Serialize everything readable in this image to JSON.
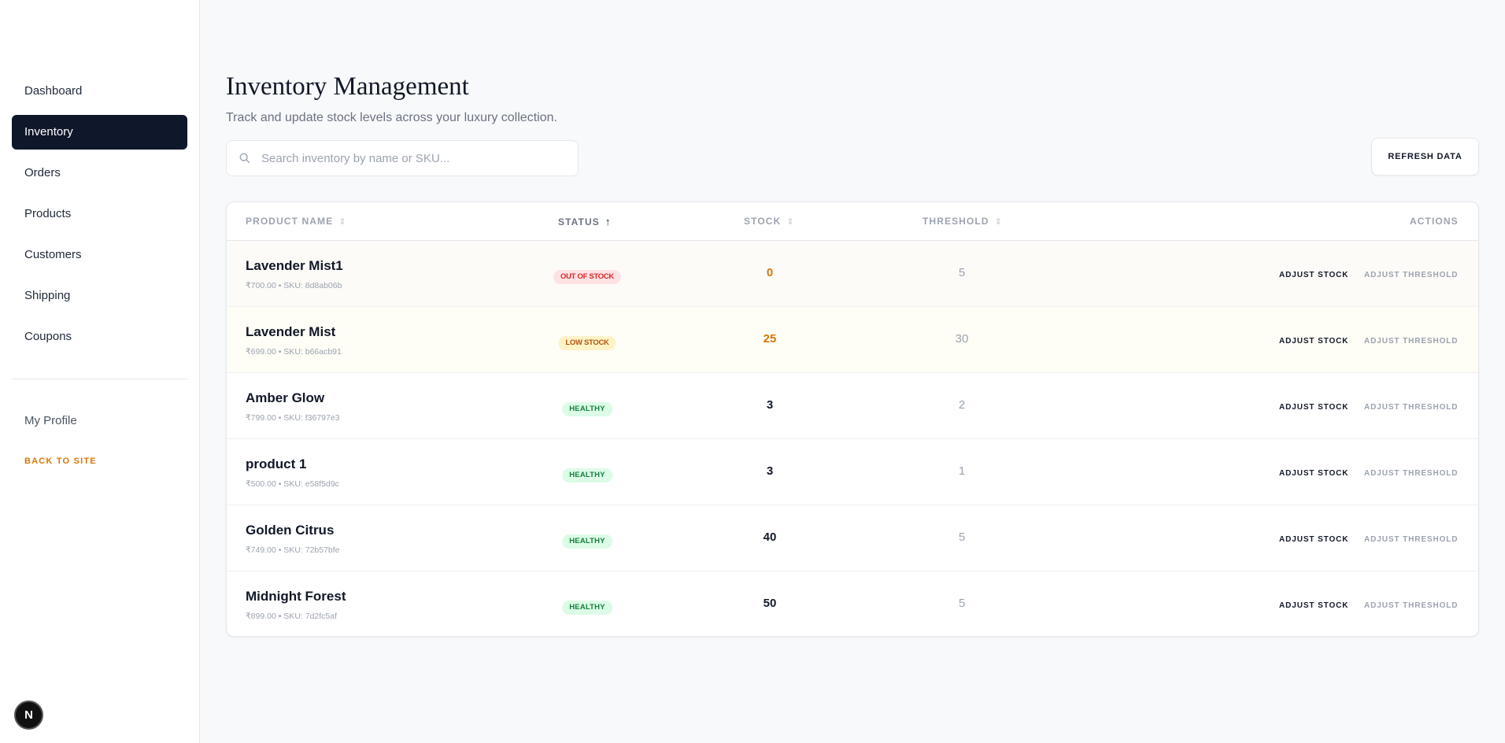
{
  "sidebar": {
    "items": [
      {
        "label": "Dashboard"
      },
      {
        "label": "Inventory"
      },
      {
        "label": "Orders"
      },
      {
        "label": "Products"
      },
      {
        "label": "Customers"
      },
      {
        "label": "Shipping"
      },
      {
        "label": "Coupons"
      }
    ],
    "active_index": 1,
    "profile_label": "My Profile",
    "back_label": "BACK TO SITE",
    "badge_letter": "N"
  },
  "header": {
    "title": "Inventory Management",
    "subtitle": "Track and update stock levels across your luxury collection."
  },
  "search": {
    "placeholder": "Search inventory by name or SKU...",
    "value": "",
    "icon": "search-icon"
  },
  "toolbar": {
    "refresh_label": "REFRESH DATA"
  },
  "table": {
    "columns": {
      "name": "PRODUCT NAME",
      "status": "STATUS",
      "stock": "STOCK",
      "threshold": "THRESHOLD",
      "actions": "ACTIONS"
    },
    "sorted_column": "status",
    "sort_direction": "ascending",
    "rows": [
      {
        "name": "Lavender Mist1",
        "meta": "₹700.00 • SKU: 8d8ab06b",
        "status": "OUT OF STOCK",
        "stock": "0",
        "threshold": "5",
        "adjust_stock": "ADJUST STOCK",
        "adjust_threshold": "ADJUST THRESHOLD"
      },
      {
        "name": "Lavender Mist",
        "meta": "₹699.00 • SKU: b66acb91",
        "status": "LOW STOCK",
        "stock": "25",
        "threshold": "30",
        "adjust_stock": "ADJUST STOCK",
        "adjust_threshold": "ADJUST THRESHOLD"
      },
      {
        "name": "Amber Glow",
        "meta": "₹799.00 • SKU: f36797e3",
        "status": "HEALTHY",
        "stock": "3",
        "threshold": "2",
        "adjust_stock": "ADJUST STOCK",
        "adjust_threshold": "ADJUST THRESHOLD"
      },
      {
        "name": "product 1",
        "meta": "₹500.00 • SKU: e58f5d9c",
        "status": "HEALTHY",
        "stock": "3",
        "threshold": "1",
        "adjust_stock": "ADJUST STOCK",
        "adjust_threshold": "ADJUST THRESHOLD"
      },
      {
        "name": "Golden Citrus",
        "meta": "₹749.00 • SKU: 72b57bfe",
        "status": "HEALTHY",
        "stock": "40",
        "threshold": "5",
        "adjust_stock": "ADJUST STOCK",
        "adjust_threshold": "ADJUST THRESHOLD"
      },
      {
        "name": "Midnight Forest",
        "meta": "₹899.00 • SKU: 7d2fc5af",
        "status": "HEALTHY",
        "stock": "50",
        "threshold": "5",
        "adjust_stock": "ADJUST STOCK",
        "adjust_threshold": "ADJUST THRESHOLD"
      }
    ]
  },
  "colors": {
    "active_nav": "#0f172a",
    "accent": "#d97706",
    "out_of_stock_bg": "#fde2e4",
    "out_of_stock_text": "#dc2626",
    "low_stock_bg": "#fef3c7",
    "low_stock_text": "#b45309",
    "healthy_bg": "#dcfce7",
    "healthy_text": "#15803d"
  }
}
